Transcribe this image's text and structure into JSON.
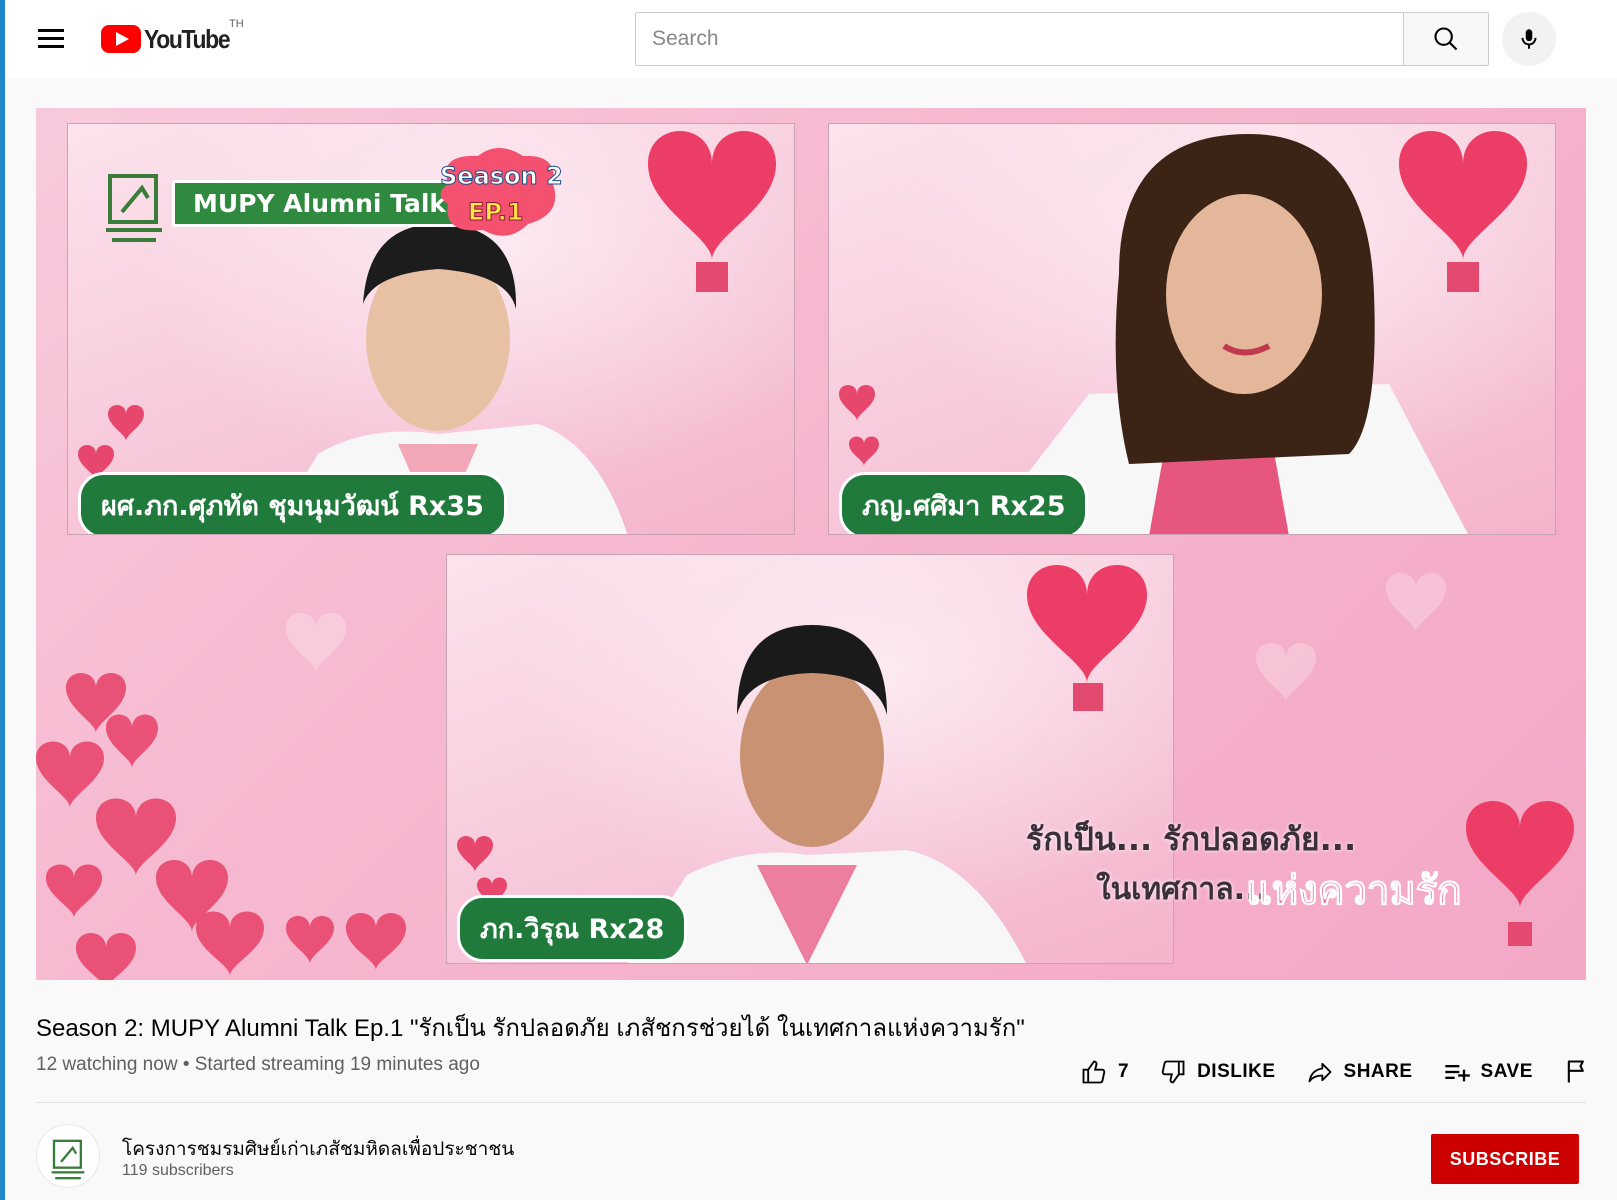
{
  "header": {
    "logo_text": "YouTube",
    "country_code": "TH",
    "search_placeholder": "Search"
  },
  "video": {
    "overlay": {
      "banner": "MUPY Alumni Talk",
      "badge_line1": "Season 2",
      "badge_line2": "EP.1",
      "speakers": [
        {
          "name": "ผศ.ภก.ศุภทัต ชุมนุมวัฒน์ Rx35"
        },
        {
          "name": "ภญ.ศศิมา Rx25"
        },
        {
          "name": "ภก.วิรุณ Rx28"
        }
      ],
      "tagline1": "รักเป็น... รักปลอดภัย...",
      "tagline2": "ในเทศกาล...",
      "tagline3": "แห่งความรัก"
    }
  },
  "info": {
    "title": "Season 2: MUPY Alumni Talk Ep.1 \"รักเป็น รักปลอดภัย เภสัชกรช่วยได้ ในเทศกาลแห่งความรัก\"",
    "meta": "12 watching now • Started streaming 19 minutes ago",
    "like_count": "7",
    "dislike_label": "DISLIKE",
    "share_label": "SHARE",
    "save_label": "SAVE"
  },
  "channel": {
    "name": "โครงการชมรมศิษย์เก่าเภสัชมหิดลเพื่อประชาชน",
    "subscribers": "119 subscribers",
    "subscribe_label": "SUBSCRIBE"
  },
  "colors": {
    "brand_red": "#ff0000",
    "subscribe_red": "#cc0000",
    "tag_green": "#1f7a3c",
    "video_pink": "#f6b8d0"
  },
  "icons": [
    "menu-icon",
    "youtube-logo-icon",
    "search-icon",
    "mic-icon",
    "like-icon",
    "dislike-icon",
    "share-icon",
    "save-icon",
    "flag-icon"
  ]
}
